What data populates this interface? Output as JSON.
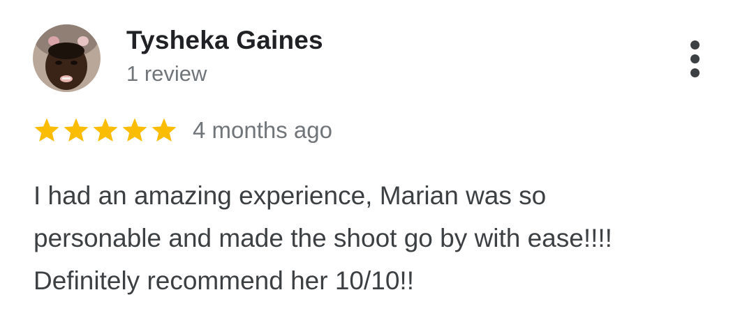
{
  "review": {
    "reviewer_name": "Tysheka Gaines",
    "review_count": "1 review",
    "avatar_icon": "reviewer-photo",
    "menu_icon": "more-vert-icon",
    "rating": 5,
    "rating_max": 5,
    "star_color": "#fbbc04",
    "time_ago": "4 months ago",
    "text_lines": [
      "I had an amazing experience, Marian was so",
      "personable and made the shoot go by with ease!!!!",
      "Definitely recommend her 10/10!!"
    ]
  }
}
